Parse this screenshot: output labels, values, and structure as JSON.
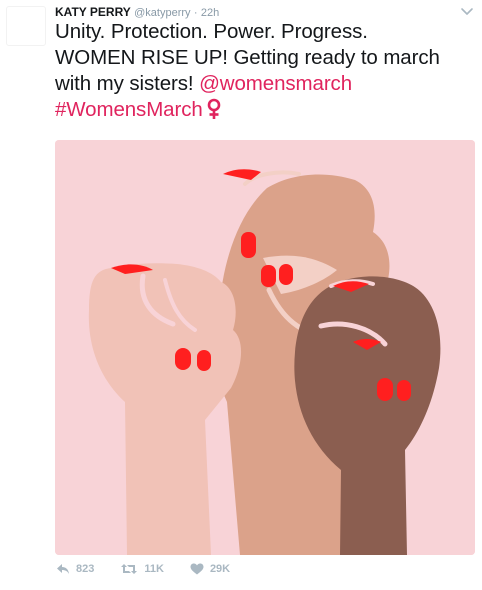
{
  "tweet": {
    "author_name": "KATY PERRY",
    "author_handle": "@katyperry",
    "separator": "·",
    "time": "22h",
    "text_line1": "Unity. Protection. Power. Progress.",
    "text_line2": "WOMEN RISE UP! Getting ready to march",
    "text_line3_plain": "with my sisters! ",
    "mention": "@womensmarch",
    "hashtag": "#WomensMarch",
    "emoji": "venus-symbol"
  },
  "media": {
    "alt": "Illustration of three raised fists with red painted nails",
    "background_color": "#f8d3d7"
  },
  "actions": {
    "reply_count": "823",
    "retweet_count": "11K",
    "like_count": "29K"
  },
  "colors": {
    "link": "#e0245e",
    "muted": "#8899a6",
    "action": "#aab8c2"
  }
}
